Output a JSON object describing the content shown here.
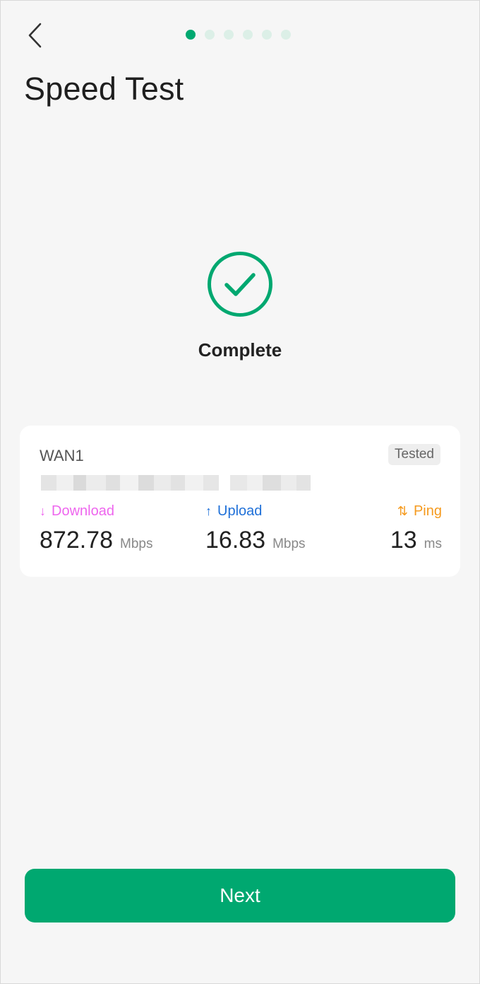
{
  "header": {
    "title": "Speed Test",
    "back_icon": "chevron-left-icon",
    "progress": {
      "total_steps": 6,
      "current_step": 1
    }
  },
  "status": {
    "icon": "check-circle-icon",
    "text": "Complete",
    "accent_color": "#00a870"
  },
  "result_card": {
    "wan_name": "WAN1",
    "badge": "Tested",
    "metrics": {
      "download": {
        "icon": "arrow-down-icon",
        "glyph": "↓",
        "label": "Download",
        "value": "872.78",
        "unit": "Mbps",
        "color": "#ee66ee"
      },
      "upload": {
        "icon": "arrow-up-icon",
        "glyph": "↑",
        "label": "Upload",
        "value": "16.83",
        "unit": "Mbps",
        "color": "#1f70d8"
      },
      "ping": {
        "icon": "swap-vertical-icon",
        "glyph": "⇅",
        "label": "Ping",
        "value": "13",
        "unit": "ms",
        "color": "#f59a1e"
      }
    }
  },
  "footer": {
    "next_label": "Next",
    "button_color": "#00a870"
  }
}
